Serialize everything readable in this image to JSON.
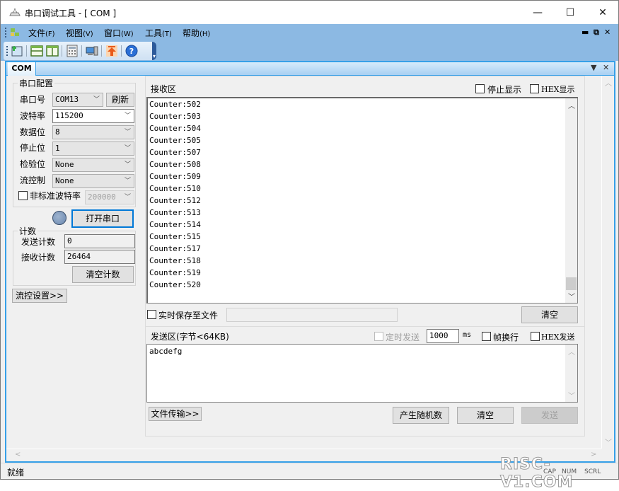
{
  "window": {
    "title": "串口调试工具 - [ COM ]",
    "controls": {
      "minimize": "—",
      "maximize": "☐",
      "close": "✕"
    }
  },
  "menubar": {
    "items": [
      {
        "label": "文件",
        "accel": "(F)"
      },
      {
        "label": "视图",
        "accel": "(V)"
      },
      {
        "label": "窗口",
        "accel": "(W)"
      },
      {
        "label": "工具",
        "accel": "(T)"
      },
      {
        "label": "帮助",
        "accel": "(H)"
      }
    ],
    "mdi_controls": {
      "minimize": "▬",
      "restore": "⧉",
      "close": "✕"
    }
  },
  "toolbar": {
    "buttons": [
      "new-document",
      "horizontal-split",
      "vertical-split",
      "calculator",
      "computer-network",
      "upload",
      "help"
    ]
  },
  "tabs": [
    {
      "label": "COM",
      "active": true
    }
  ],
  "tab_controls": {
    "dropdown": "▼",
    "close": "✕"
  },
  "serial_config": {
    "title": "串口配置",
    "port": {
      "label": "串口号",
      "value": "COM13",
      "refresh": "刷新"
    },
    "baud": {
      "label": "波特率",
      "value": "115200"
    },
    "data_bits": {
      "label": "数据位",
      "value": "8"
    },
    "stop_bits": {
      "label": "停止位",
      "value": "1"
    },
    "parity": {
      "label": "检验位",
      "value": "None"
    },
    "flow": {
      "label": "流控制",
      "value": "None"
    },
    "custom_baud": {
      "label": "非标准波特率",
      "value": "200000",
      "checked": false
    },
    "open_button": "打开串口"
  },
  "counter": {
    "title": "计数",
    "sent": {
      "label": "发送计数",
      "value": "0"
    },
    "received": {
      "label": "接收计数",
      "value": "26464"
    },
    "clear_button": "清空计数"
  },
  "flow_settings_button": "流控设置>>",
  "receive": {
    "title": "接收区",
    "stop_display": {
      "label": "停止显示",
      "checked": false
    },
    "hex_display": {
      "label": "HEX显示",
      "checked": false
    },
    "lines": [
      "Counter:502",
      "Counter:503",
      "Counter:504",
      "Counter:505",
      "Counter:507",
      "Counter:508",
      "Counter:509",
      "Counter:510",
      "Counter:512",
      "Counter:513",
      "Counter:514",
      "Counter:515",
      "Counter:517",
      "Counter:518",
      "Counter:519",
      "Counter:520"
    ],
    "save_to_file": {
      "label": "实时保存至文件",
      "checked": false,
      "path": ""
    },
    "clear_button": "清空"
  },
  "send": {
    "title": "发送区(字节<64KB)",
    "timed_send": {
      "label": "定时发送",
      "checked": false,
      "interval": "1000",
      "unit": "ms"
    },
    "frame_newline": {
      "label": "帧换行",
      "checked": false
    },
    "hex_send": {
      "label": "HEX发送",
      "checked": false
    },
    "text": "abcdefg",
    "file_transfer_button": "文件传输>>",
    "random_button": "产生随机数",
    "clear_button": "清空",
    "send_button": "发送"
  },
  "statusbar": {
    "text": "就绪",
    "indicators": [
      "CAP",
      "NUM",
      "SCRL"
    ]
  },
  "watermark": "RISC-V1.COM"
}
